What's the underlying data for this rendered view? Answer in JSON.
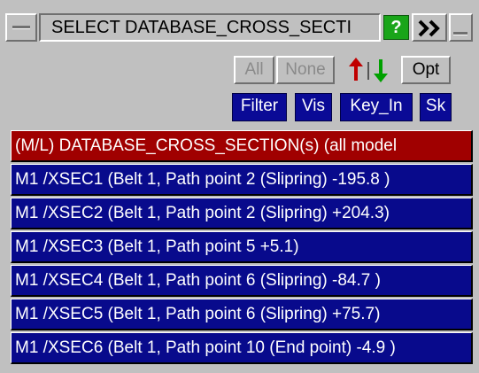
{
  "title_bar": {
    "title": "SELECT DATABASE_CROSS_SECTI",
    "help_label": "?",
    "expand_icon": "double-chevron-right-icon",
    "menu_icon": "window-menu-icon",
    "minimize_icon": "minimize-icon"
  },
  "toolbar": {
    "all_label": "All",
    "none_label": "None",
    "opt_label": "Opt",
    "filter_label": "Filter",
    "vis_label": "Vis",
    "keyin_label": "Key_In",
    "sk_label": "Sk",
    "sort_icon": "sort-up-down-arrows-icon"
  },
  "colors": {
    "panel_bg": "#c0c0c0",
    "header_row": "#a00000",
    "item_row": "#080a8c",
    "help_button": "#19a519",
    "sort_up_arrow": "#c00000",
    "sort_down_arrow": "#00a000"
  },
  "list": {
    "header": "(M/L) DATABASE_CROSS_SECTION(s) (all model",
    "items": [
      "M1 /XSEC1 (Belt 1, Path point 2 (Slipring) -195.8 )",
      "M1 /XSEC2 (Belt 1, Path point 2 (Slipring) +204.3)",
      "M1 /XSEC3 (Belt 1, Path point 5 +5.1)",
      "M1 /XSEC4 (Belt 1, Path point 6 (Slipring) -84.7 )",
      "M1 /XSEC5 (Belt 1, Path point 6 (Slipring) +75.7)",
      "M1 /XSEC6 (Belt 1, Path point 10 (End point) -4.9 )"
    ]
  }
}
